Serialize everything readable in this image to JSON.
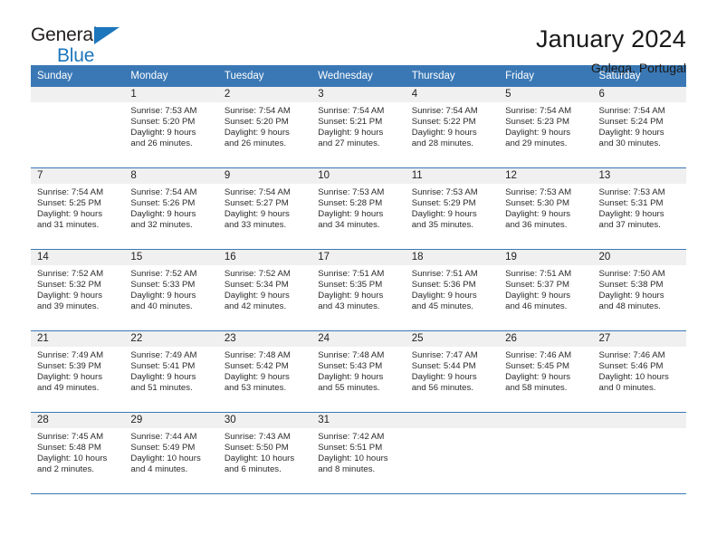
{
  "brand": {
    "name_part1": "General",
    "name_part2": "Blue",
    "accent_color": "#1c76bc"
  },
  "header": {
    "title": "January 2024",
    "subtitle": "Golega, Portugal"
  },
  "calendar": {
    "header_bg": "#3a78b5",
    "daynum_bg": "#f0f0f0",
    "weekdays": [
      "Sunday",
      "Monday",
      "Tuesday",
      "Wednesday",
      "Thursday",
      "Friday",
      "Saturday"
    ],
    "weeks": [
      [
        {
          "day": "",
          "sunrise": "",
          "sunset": "",
          "daylight_line1": "",
          "daylight_line2": ""
        },
        {
          "day": "1",
          "sunrise": "Sunrise: 7:53 AM",
          "sunset": "Sunset: 5:20 PM",
          "daylight_line1": "Daylight: 9 hours",
          "daylight_line2": "and 26 minutes."
        },
        {
          "day": "2",
          "sunrise": "Sunrise: 7:54 AM",
          "sunset": "Sunset: 5:20 PM",
          "daylight_line1": "Daylight: 9 hours",
          "daylight_line2": "and 26 minutes."
        },
        {
          "day": "3",
          "sunrise": "Sunrise: 7:54 AM",
          "sunset": "Sunset: 5:21 PM",
          "daylight_line1": "Daylight: 9 hours",
          "daylight_line2": "and 27 minutes."
        },
        {
          "day": "4",
          "sunrise": "Sunrise: 7:54 AM",
          "sunset": "Sunset: 5:22 PM",
          "daylight_line1": "Daylight: 9 hours",
          "daylight_line2": "and 28 minutes."
        },
        {
          "day": "5",
          "sunrise": "Sunrise: 7:54 AM",
          "sunset": "Sunset: 5:23 PM",
          "daylight_line1": "Daylight: 9 hours",
          "daylight_line2": "and 29 minutes."
        },
        {
          "day": "6",
          "sunrise": "Sunrise: 7:54 AM",
          "sunset": "Sunset: 5:24 PM",
          "daylight_line1": "Daylight: 9 hours",
          "daylight_line2": "and 30 minutes."
        }
      ],
      [
        {
          "day": "7",
          "sunrise": "Sunrise: 7:54 AM",
          "sunset": "Sunset: 5:25 PM",
          "daylight_line1": "Daylight: 9 hours",
          "daylight_line2": "and 31 minutes."
        },
        {
          "day": "8",
          "sunrise": "Sunrise: 7:54 AM",
          "sunset": "Sunset: 5:26 PM",
          "daylight_line1": "Daylight: 9 hours",
          "daylight_line2": "and 32 minutes."
        },
        {
          "day": "9",
          "sunrise": "Sunrise: 7:54 AM",
          "sunset": "Sunset: 5:27 PM",
          "daylight_line1": "Daylight: 9 hours",
          "daylight_line2": "and 33 minutes."
        },
        {
          "day": "10",
          "sunrise": "Sunrise: 7:53 AM",
          "sunset": "Sunset: 5:28 PM",
          "daylight_line1": "Daylight: 9 hours",
          "daylight_line2": "and 34 minutes."
        },
        {
          "day": "11",
          "sunrise": "Sunrise: 7:53 AM",
          "sunset": "Sunset: 5:29 PM",
          "daylight_line1": "Daylight: 9 hours",
          "daylight_line2": "and 35 minutes."
        },
        {
          "day": "12",
          "sunrise": "Sunrise: 7:53 AM",
          "sunset": "Sunset: 5:30 PM",
          "daylight_line1": "Daylight: 9 hours",
          "daylight_line2": "and 36 minutes."
        },
        {
          "day": "13",
          "sunrise": "Sunrise: 7:53 AM",
          "sunset": "Sunset: 5:31 PM",
          "daylight_line1": "Daylight: 9 hours",
          "daylight_line2": "and 37 minutes."
        }
      ],
      [
        {
          "day": "14",
          "sunrise": "Sunrise: 7:52 AM",
          "sunset": "Sunset: 5:32 PM",
          "daylight_line1": "Daylight: 9 hours",
          "daylight_line2": "and 39 minutes."
        },
        {
          "day": "15",
          "sunrise": "Sunrise: 7:52 AM",
          "sunset": "Sunset: 5:33 PM",
          "daylight_line1": "Daylight: 9 hours",
          "daylight_line2": "and 40 minutes."
        },
        {
          "day": "16",
          "sunrise": "Sunrise: 7:52 AM",
          "sunset": "Sunset: 5:34 PM",
          "daylight_line1": "Daylight: 9 hours",
          "daylight_line2": "and 42 minutes."
        },
        {
          "day": "17",
          "sunrise": "Sunrise: 7:51 AM",
          "sunset": "Sunset: 5:35 PM",
          "daylight_line1": "Daylight: 9 hours",
          "daylight_line2": "and 43 minutes."
        },
        {
          "day": "18",
          "sunrise": "Sunrise: 7:51 AM",
          "sunset": "Sunset: 5:36 PM",
          "daylight_line1": "Daylight: 9 hours",
          "daylight_line2": "and 45 minutes."
        },
        {
          "day": "19",
          "sunrise": "Sunrise: 7:51 AM",
          "sunset": "Sunset: 5:37 PM",
          "daylight_line1": "Daylight: 9 hours",
          "daylight_line2": "and 46 minutes."
        },
        {
          "day": "20",
          "sunrise": "Sunrise: 7:50 AM",
          "sunset": "Sunset: 5:38 PM",
          "daylight_line1": "Daylight: 9 hours",
          "daylight_line2": "and 48 minutes."
        }
      ],
      [
        {
          "day": "21",
          "sunrise": "Sunrise: 7:49 AM",
          "sunset": "Sunset: 5:39 PM",
          "daylight_line1": "Daylight: 9 hours",
          "daylight_line2": "and 49 minutes."
        },
        {
          "day": "22",
          "sunrise": "Sunrise: 7:49 AM",
          "sunset": "Sunset: 5:41 PM",
          "daylight_line1": "Daylight: 9 hours",
          "daylight_line2": "and 51 minutes."
        },
        {
          "day": "23",
          "sunrise": "Sunrise: 7:48 AM",
          "sunset": "Sunset: 5:42 PM",
          "daylight_line1": "Daylight: 9 hours",
          "daylight_line2": "and 53 minutes."
        },
        {
          "day": "24",
          "sunrise": "Sunrise: 7:48 AM",
          "sunset": "Sunset: 5:43 PM",
          "daylight_line1": "Daylight: 9 hours",
          "daylight_line2": "and 55 minutes."
        },
        {
          "day": "25",
          "sunrise": "Sunrise: 7:47 AM",
          "sunset": "Sunset: 5:44 PM",
          "daylight_line1": "Daylight: 9 hours",
          "daylight_line2": "and 56 minutes."
        },
        {
          "day": "26",
          "sunrise": "Sunrise: 7:46 AM",
          "sunset": "Sunset: 5:45 PM",
          "daylight_line1": "Daylight: 9 hours",
          "daylight_line2": "and 58 minutes."
        },
        {
          "day": "27",
          "sunrise": "Sunrise: 7:46 AM",
          "sunset": "Sunset: 5:46 PM",
          "daylight_line1": "Daylight: 10 hours",
          "daylight_line2": "and 0 minutes."
        }
      ],
      [
        {
          "day": "28",
          "sunrise": "Sunrise: 7:45 AM",
          "sunset": "Sunset: 5:48 PM",
          "daylight_line1": "Daylight: 10 hours",
          "daylight_line2": "and 2 minutes."
        },
        {
          "day": "29",
          "sunrise": "Sunrise: 7:44 AM",
          "sunset": "Sunset: 5:49 PM",
          "daylight_line1": "Daylight: 10 hours",
          "daylight_line2": "and 4 minutes."
        },
        {
          "day": "30",
          "sunrise": "Sunrise: 7:43 AM",
          "sunset": "Sunset: 5:50 PM",
          "daylight_line1": "Daylight: 10 hours",
          "daylight_line2": "and 6 minutes."
        },
        {
          "day": "31",
          "sunrise": "Sunrise: 7:42 AM",
          "sunset": "Sunset: 5:51 PM",
          "daylight_line1": "Daylight: 10 hours",
          "daylight_line2": "and 8 minutes."
        },
        {
          "day": "",
          "sunrise": "",
          "sunset": "",
          "daylight_line1": "",
          "daylight_line2": ""
        },
        {
          "day": "",
          "sunrise": "",
          "sunset": "",
          "daylight_line1": "",
          "daylight_line2": ""
        },
        {
          "day": "",
          "sunrise": "",
          "sunset": "",
          "daylight_line1": "",
          "daylight_line2": ""
        }
      ]
    ]
  }
}
